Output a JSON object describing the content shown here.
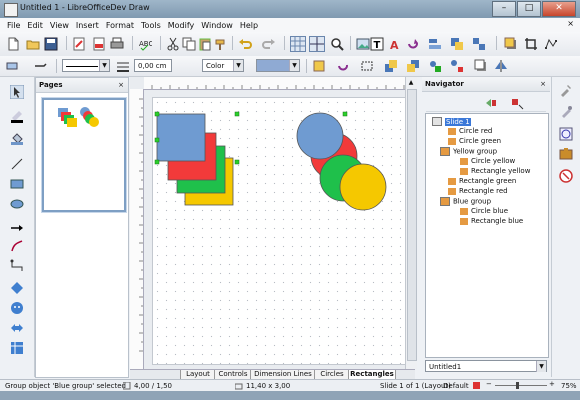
{
  "window": {
    "title": "Untitled 1 - LibreOfficeDev Draw",
    "min": "–",
    "max": "□",
    "close": "✕"
  },
  "menu": [
    "File",
    "Edit",
    "View",
    "Insert",
    "Format",
    "Tools",
    "Modify",
    "Window",
    "Help"
  ],
  "menu_close": "×",
  "toolbar2": {
    "line_width": "0,00 cm",
    "area_style": "Color"
  },
  "pages_panel": {
    "title": "Pages",
    "close": "×"
  },
  "navigator": {
    "title": "Navigator",
    "close": "×",
    "tree": [
      {
        "label": "Slide 1",
        "level": 0
      },
      {
        "label": "Circle red",
        "level": 1
      },
      {
        "label": "Circle green",
        "level": 1
      },
      {
        "label": "Yellow group",
        "level": 1
      },
      {
        "label": "Circle yellow",
        "level": 2
      },
      {
        "label": "Rectangle yellow",
        "level": 2
      },
      {
        "label": "Rectangle green",
        "level": 1
      },
      {
        "label": "Rectangle red",
        "level": 1
      },
      {
        "label": "Blue group",
        "level": 1
      },
      {
        "label": "Circle blue",
        "level": 2
      },
      {
        "label": "Rectangle blue",
        "level": 2
      }
    ],
    "document": "Untitled1"
  },
  "tabs": [
    "Layout",
    "Controls",
    "Dimension Lines",
    "Circles",
    "Rectangles"
  ],
  "active_tab": "Rectangles",
  "status": {
    "message": "Group object 'Blue group' selected",
    "position": "4,00 / 1,50",
    "size": "11,40 x 3,00",
    "slide": "Slide 1 of 1 (Layout)",
    "master": "Default",
    "zoom": "75%"
  },
  "colors": {
    "blue": "#6f9bd1",
    "red": "#f23a3a",
    "green": "#1fc04b",
    "yellow": "#f5c800",
    "selection": "#3b78d8"
  }
}
